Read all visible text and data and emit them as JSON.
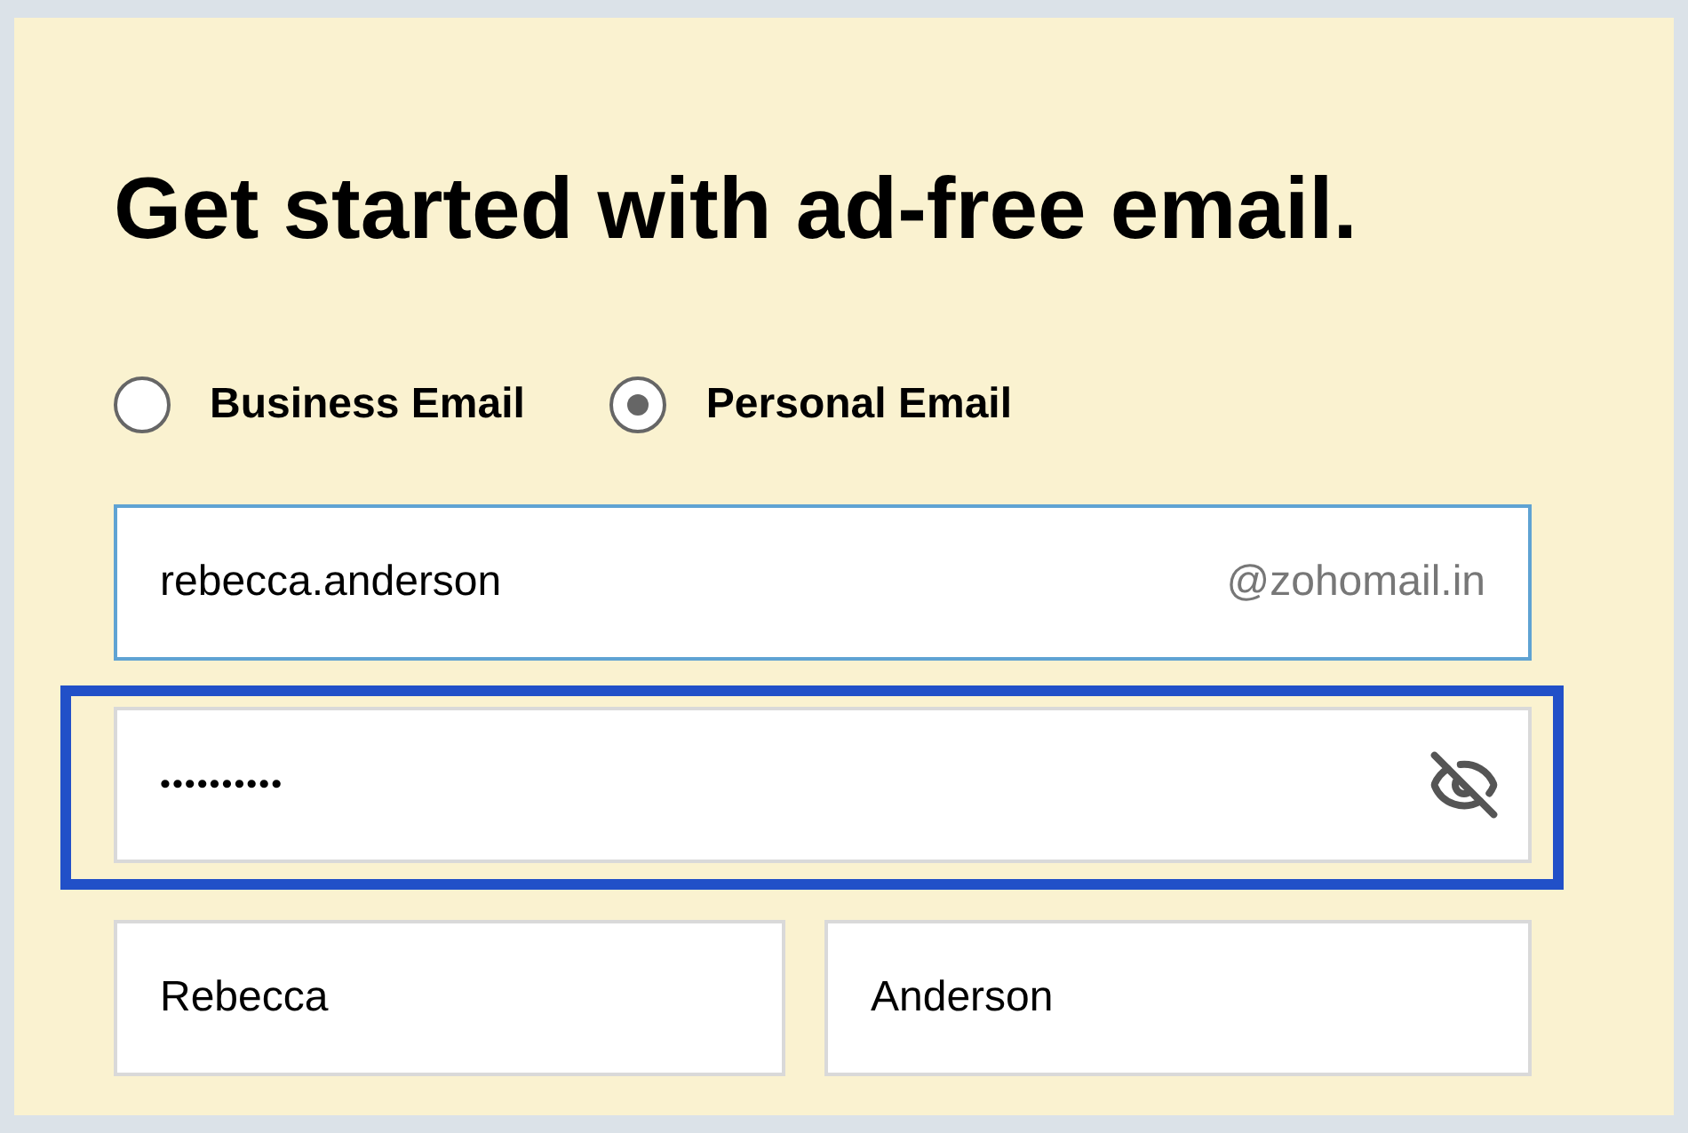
{
  "heading": "Get started with ad-free email.",
  "account_types": [
    {
      "label": "Business Email",
      "selected": false
    },
    {
      "label": "Personal Email",
      "selected": true
    }
  ],
  "email": {
    "value": "rebecca.anderson",
    "suffix": "@zohomail.in",
    "focused": true
  },
  "password": {
    "value": "••••••••••",
    "highlighted": true
  },
  "name_fields": [
    {
      "value": "Rebecca"
    },
    {
      "value": "Anderson"
    }
  ]
}
